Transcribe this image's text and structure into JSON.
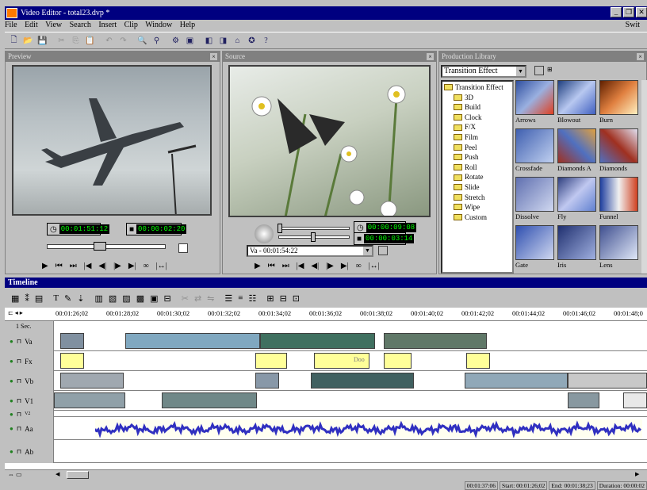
{
  "window": {
    "title": "Video Editor - total23.dvp *",
    "right_menu_text": "Swit"
  },
  "menu": [
    "File",
    "Edit",
    "View",
    "Search",
    "Insert",
    "Clip",
    "Window",
    "Help"
  ],
  "preview": {
    "title": "Preview",
    "tc_left": "00:01:51:12",
    "tc_right": "00:00:02:20"
  },
  "source": {
    "title": "Source",
    "tc_top": "00:00:09:08",
    "tc_bottom": "00:00:03:14",
    "clip_select": "Va - 00:01:54:22"
  },
  "library": {
    "title": "Production Library",
    "dropdown": "Transition Effect",
    "tree_root": "Transition Effect",
    "tree_items": [
      "3D",
      "Build",
      "Clock",
      "F/X",
      "Film",
      "Peel",
      "Push",
      "Roll",
      "Rotate",
      "Slide",
      "Stretch",
      "Wipe",
      "Custom"
    ],
    "thumbs": [
      "Arrows",
      "Blowout",
      "Burn",
      "Crossfade",
      "Diamonds A",
      "Diamonds",
      "Dissolve",
      "Fly",
      "Funnel",
      "Gate",
      "Iris",
      "Lens"
    ]
  },
  "timeline": {
    "title": "Timeline",
    "scale": "1 Sec.",
    "ticks": [
      "00:01:26;02",
      "00:01:28;02",
      "00:01:30;02",
      "00:01:32;02",
      "00:01:34;02",
      "00:01:36;02",
      "00:01:38;02",
      "00:01:40;02",
      "00:01:42;02",
      "00:01:44;02",
      "00:01:46;02",
      "00:01:48;0"
    ],
    "tracks": [
      "Va",
      "Fx",
      "Vb",
      "V1",
      "V2",
      "Aa",
      "Ab"
    ],
    "fx_label": "Doo"
  },
  "status": [
    "00:01:37:06",
    "Start: 00:01:26;02",
    "End: 00:01:38;23",
    "Duration: 00:00:02"
  ],
  "colors": {
    "titlebar": "#000080",
    "waveform": "#3030c0",
    "waveform_bg": "#fffff0",
    "fx_clip": "#ffff99",
    "timecode": "#00ff00"
  }
}
